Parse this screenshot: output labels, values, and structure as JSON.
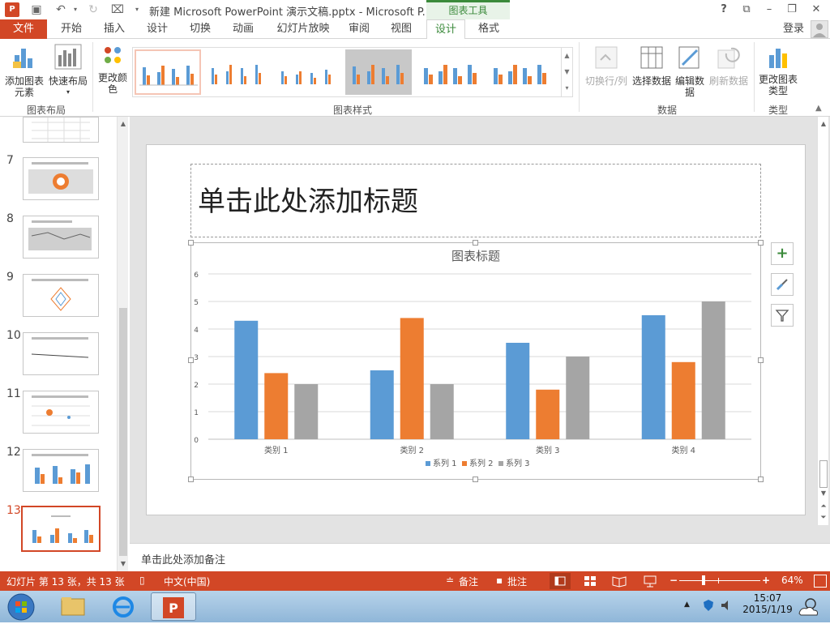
{
  "window": {
    "title": "新建 Microsoft PowerPoint 演示文稿.pptx - Microsoft P...",
    "context_tab_group": "图表工具",
    "help": "?",
    "login": "登录"
  },
  "menu": {
    "file": "文件",
    "tabs": [
      "开始",
      "插入",
      "设计",
      "切换",
      "动画",
      "幻灯片放映",
      "审阅",
      "视图",
      "设计",
      "格式"
    ],
    "active_index": 8
  },
  "ribbon": {
    "add_element": "添加图表元素",
    "quick_layout": "快速布局",
    "change_color": "更改颜色",
    "group_layout": "图表布局",
    "group_styles": "图表样式",
    "switch_rowcol": "切换行/列",
    "select_data": "选择数据",
    "edit_data": "编辑数据",
    "refresh_data": "刷新数据",
    "group_data": "数据",
    "change_type": "更改图表类型",
    "group_type": "类型"
  },
  "slides": {
    "numbers": [
      "7",
      "8",
      "9",
      "10",
      "11",
      "12",
      "13"
    ],
    "current": "13"
  },
  "slide": {
    "title_placeholder": "单击此处添加标题"
  },
  "chart_data": {
    "type": "bar",
    "title": "图表标题",
    "categories": [
      "类别 1",
      "类别 2",
      "类别 3",
      "类别 4"
    ],
    "series": [
      {
        "name": "系列 1",
        "values": [
          4.3,
          2.5,
          3.5,
          4.5
        ],
        "color": "#5b9bd5"
      },
      {
        "name": "系列 2",
        "values": [
          2.4,
          4.4,
          1.8,
          2.8
        ],
        "color": "#ed7d31"
      },
      {
        "name": "系列 3",
        "values": [
          2,
          2,
          3,
          5
        ],
        "color": "#a5a5a5"
      }
    ],
    "ylim": [
      0,
      6
    ],
    "yticks": [
      "0",
      "1",
      "2",
      "3",
      "4",
      "5",
      "6"
    ],
    "grid": true,
    "legend": "bottom"
  },
  "notes": {
    "placeholder": "单击此处添加备注"
  },
  "status": {
    "slide_info": "幻灯片 第 13 张，共 13 张",
    "language": "中文(中国)",
    "notes": "备注",
    "comments": "批注",
    "zoom": "64%"
  },
  "taskbar": {
    "time": "15:07",
    "date": "2015/1/19"
  },
  "colors": {
    "accent": "#d24726",
    "context_green": "#3b8a3b"
  }
}
